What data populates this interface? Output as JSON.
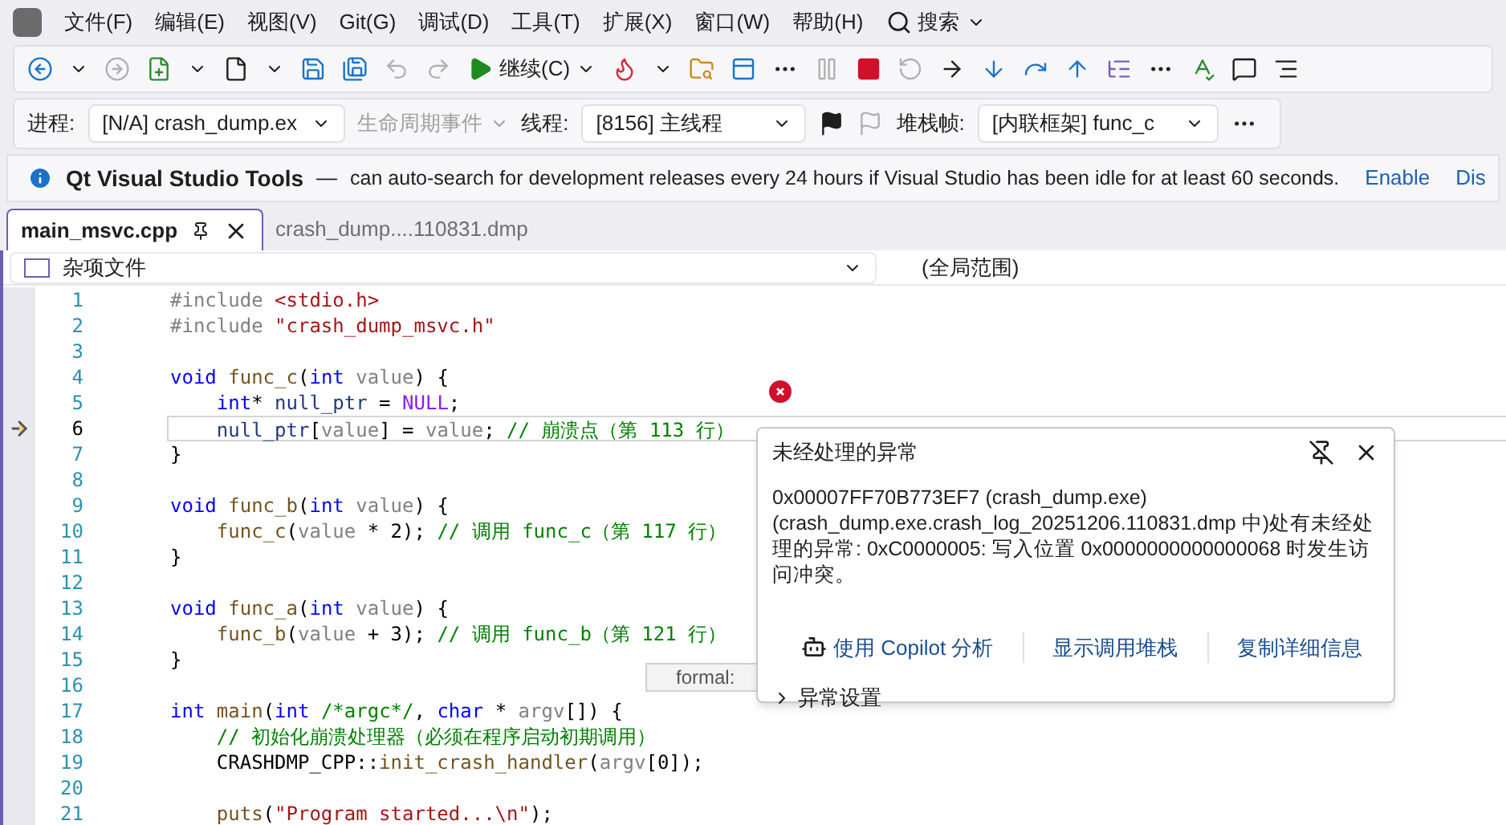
{
  "menu": {
    "items": [
      "文件(F)",
      "编辑(E)",
      "视图(V)",
      "Git(G)",
      "调试(D)",
      "工具(T)",
      "扩展(X)",
      "窗口(W)",
      "帮助(H)"
    ],
    "search": "搜索"
  },
  "toolbar": {
    "continue": "继续(C)"
  },
  "debug_location": {
    "process_label": "进程:",
    "process": "[N/A] crash_dump.ex",
    "lifecycle": "生命周期事件",
    "lifecycle_disabled": true,
    "thread_label": "线程:",
    "thread": "[8156] 主线程",
    "stack_label": "堆栈帧:",
    "stack": "[内联框架] func_c"
  },
  "info_bar": {
    "title": "Qt Visual Studio Tools",
    "dash": "—",
    "message": "can auto-search for development releases every 24 hours if Visual Studio has been idle for at least 60 seconds.",
    "actions": [
      "Enable",
      "Dis"
    ]
  },
  "tabs": [
    {
      "label": "main_msvc.cpp",
      "selected": true
    },
    {
      "label": "crash_dump....110831.dmp",
      "selected": false
    }
  ],
  "nav": {
    "scope": "杂项文件",
    "member": "(全局范围)"
  },
  "code": {
    "lines": [
      {
        "number": "1",
        "current": false,
        "tokens": [
          {
            "kind": "pre",
            "t": "#include "
          },
          {
            "kind": "str",
            "t": "<stdio.h>"
          }
        ]
      },
      {
        "number": "2",
        "current": false,
        "tokens": [
          {
            "kind": "pre",
            "t": "#include "
          },
          {
            "kind": "str",
            "t": "\"crash_dump_msvc.h\""
          }
        ]
      },
      {
        "number": "3",
        "current": false
      },
      {
        "number": "4",
        "current": false,
        "tokens": [
          {
            "kind": "kw",
            "t": "void "
          },
          {
            "kind": "fn",
            "t": "func_c"
          },
          {
            "kind": "p",
            "t": "("
          },
          {
            "kind": "kw",
            "t": "int "
          },
          {
            "kind": "var",
            "t": "value"
          },
          {
            "kind": "p",
            "t": ") {"
          }
        ]
      },
      {
        "number": "5",
        "current": false,
        "tokens": [
          {
            "kind": "kw",
            "t": "    int"
          },
          {
            "kind": "p",
            "t": "* "
          },
          {
            "kind": "loc",
            "t": "null_ptr"
          },
          {
            "kind": "p",
            "t": " = "
          },
          {
            "kind": "mac",
            "t": "NULL"
          },
          {
            "kind": "p",
            "t": ";"
          }
        ]
      },
      {
        "number": "6",
        "current": true,
        "tokens": [
          {
            "kind": "loc",
            "t": "    null_ptr"
          },
          {
            "kind": "p",
            "t": "["
          },
          {
            "kind": "var",
            "t": "value"
          },
          {
            "kind": "p",
            "t": "] = "
          },
          {
            "kind": "var",
            "t": "value"
          },
          {
            "kind": "p",
            "t": "; "
          },
          {
            "kind": "com",
            "t": "// 崩溃点（第 113 行）"
          }
        ]
      },
      {
        "number": "7",
        "current": false,
        "tokens": [
          {
            "kind": "p",
            "t": "}"
          }
        ]
      },
      {
        "number": "8",
        "current": false
      },
      {
        "number": "9",
        "current": false,
        "tokens": [
          {
            "kind": "kw",
            "t": "void "
          },
          {
            "kind": "fn",
            "t": "func_b"
          },
          {
            "kind": "p",
            "t": "("
          },
          {
            "kind": "kw",
            "t": "int "
          },
          {
            "kind": "var",
            "t": "value"
          },
          {
            "kind": "p",
            "t": ") {"
          }
        ]
      },
      {
        "number": "10",
        "current": false,
        "tokens": [
          {
            "kind": "fn",
            "t": "    func_c"
          },
          {
            "kind": "p",
            "t": "("
          },
          {
            "kind": "var",
            "t": "value"
          },
          {
            "kind": "p",
            "t": " * 2); "
          },
          {
            "kind": "com",
            "t": "// 调用 func_c（第 117 行）"
          }
        ]
      },
      {
        "number": "11",
        "current": false,
        "tokens": [
          {
            "kind": "p",
            "t": "}"
          }
        ]
      },
      {
        "number": "12",
        "current": false
      },
      {
        "number": "13",
        "current": false,
        "tokens": [
          {
            "kind": "kw",
            "t": "void "
          },
          {
            "kind": "fn",
            "t": "func_a"
          },
          {
            "kind": "p",
            "t": "("
          },
          {
            "kind": "kw",
            "t": "int "
          },
          {
            "kind": "var",
            "t": "value"
          },
          {
            "kind": "p",
            "t": ") {"
          }
        ]
      },
      {
        "number": "14",
        "current": false,
        "tokens": [
          {
            "kind": "fn",
            "t": "    func_b"
          },
          {
            "kind": "p",
            "t": "("
          },
          {
            "kind": "var",
            "t": "value"
          },
          {
            "kind": "p",
            "t": " + 3); "
          },
          {
            "kind": "com",
            "t": "// 调用 func_b（第 121 行）"
          }
        ]
      },
      {
        "number": "15",
        "current": false,
        "tokens": [
          {
            "kind": "p",
            "t": "}"
          }
        ]
      },
      {
        "number": "16",
        "current": false
      },
      {
        "number": "17",
        "current": false,
        "tokens": [
          {
            "kind": "kw",
            "t": "int "
          },
          {
            "kind": "fn",
            "t": "main"
          },
          {
            "kind": "p",
            "t": "("
          },
          {
            "kind": "kw",
            "t": "int "
          },
          {
            "kind": "com",
            "t": "/*argc*/"
          },
          {
            "kind": "p",
            "t": ", "
          },
          {
            "kind": "kw",
            "t": "char "
          },
          {
            "kind": "p",
            "t": "* "
          },
          {
            "kind": "var",
            "t": "argv"
          },
          {
            "kind": "p",
            "t": "[]) {"
          }
        ]
      },
      {
        "number": "18",
        "current": false,
        "tokens": [
          {
            "kind": "com",
            "t": "    // 初始化崩溃处理器（必须在程序启动初期调用）"
          }
        ]
      },
      {
        "number": "19",
        "current": false,
        "tokens": [
          {
            "kind": "p",
            "t": "    CRASHDMP_CPP::"
          },
          {
            "kind": "fn",
            "t": "init_crash_handler"
          },
          {
            "kind": "p",
            "t": "("
          },
          {
            "kind": "var",
            "t": "argv"
          },
          {
            "kind": "p",
            "t": "[0]);"
          }
        ]
      },
      {
        "number": "20",
        "current": false
      },
      {
        "number": "21",
        "current": false,
        "tokens": [
          {
            "kind": "fn",
            "t": "    puts"
          },
          {
            "kind": "p",
            "t": "("
          },
          {
            "kind": "str",
            "t": "\"Program started...\\n\""
          },
          {
            "kind": "p",
            "t": ");"
          }
        ]
      }
    ]
  },
  "tooltip": "formal:",
  "exception": {
    "title": "未经处理的异常",
    "message": "0x00007FF70B773EF7 (crash_dump.exe) (crash_dump.exe.crash_log_20251206.110831.dmp 中)处有未经处理的异常: 0xC0000005: 写入位置 0x0000000000000068 时发生访问冲突。",
    "actions": [
      "使用 Copilot 分析",
      "显示调用堆栈",
      "复制详细信息"
    ],
    "settings": "异常设置"
  }
}
